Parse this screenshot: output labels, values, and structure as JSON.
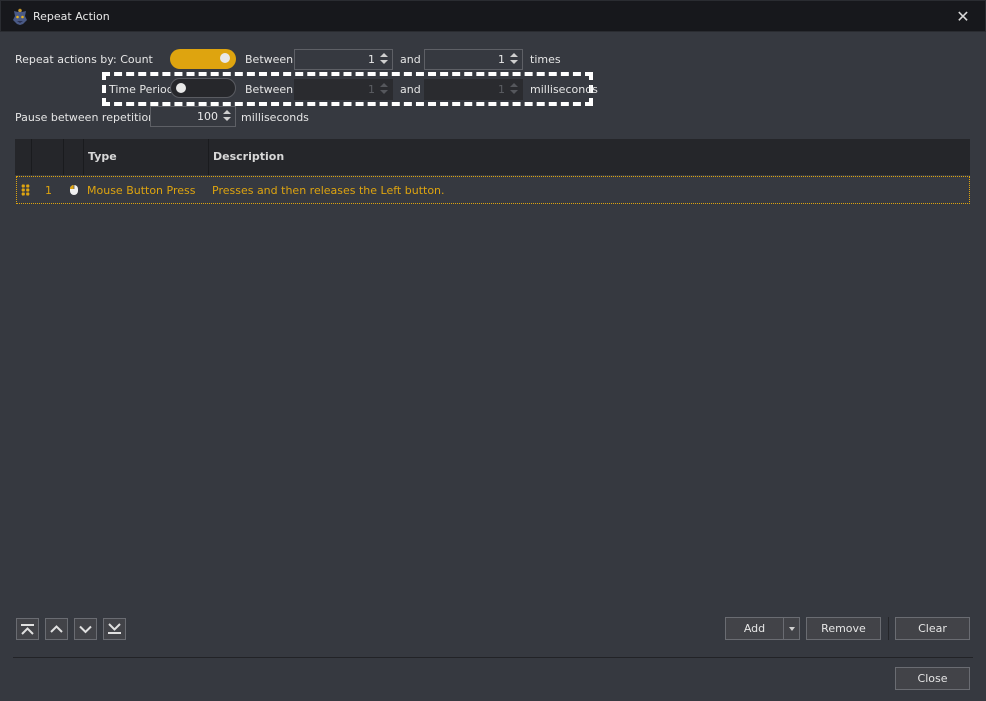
{
  "window": {
    "title": "Repeat Action",
    "app_icon": "app-logo-icon",
    "close_icon": "close-icon"
  },
  "repeat_by": {
    "label": "Repeat actions by: Count",
    "count": {
      "enabled": true,
      "between_label": "Between",
      "min": "1",
      "and_label": "and",
      "max": "1",
      "unit": "times"
    },
    "time_period": {
      "label": "Time Period",
      "enabled": false,
      "between_label": "Between",
      "min": "1",
      "and_label": "and",
      "max": "1",
      "unit": "milliseconds"
    }
  },
  "pause": {
    "label": "Pause between repetitions",
    "value": "100",
    "unit": "milliseconds"
  },
  "table": {
    "columns": [
      "",
      "",
      "",
      "Type",
      "Description"
    ],
    "rows": [
      {
        "index": "1",
        "icon": "mouse-icon",
        "type": "Mouse Button Press",
        "description": "Presses and then releases the Left button."
      }
    ]
  },
  "move_buttons": [
    "move-to-top",
    "move-up",
    "move-down",
    "move-to-bottom"
  ],
  "buttons": {
    "add": "Add",
    "remove": "Remove",
    "clear": "Clear",
    "close": "Close"
  },
  "colors": {
    "accent": "#dea40f",
    "background": "#363940",
    "titlebar": "#17181c",
    "table_header": "#25262a"
  }
}
